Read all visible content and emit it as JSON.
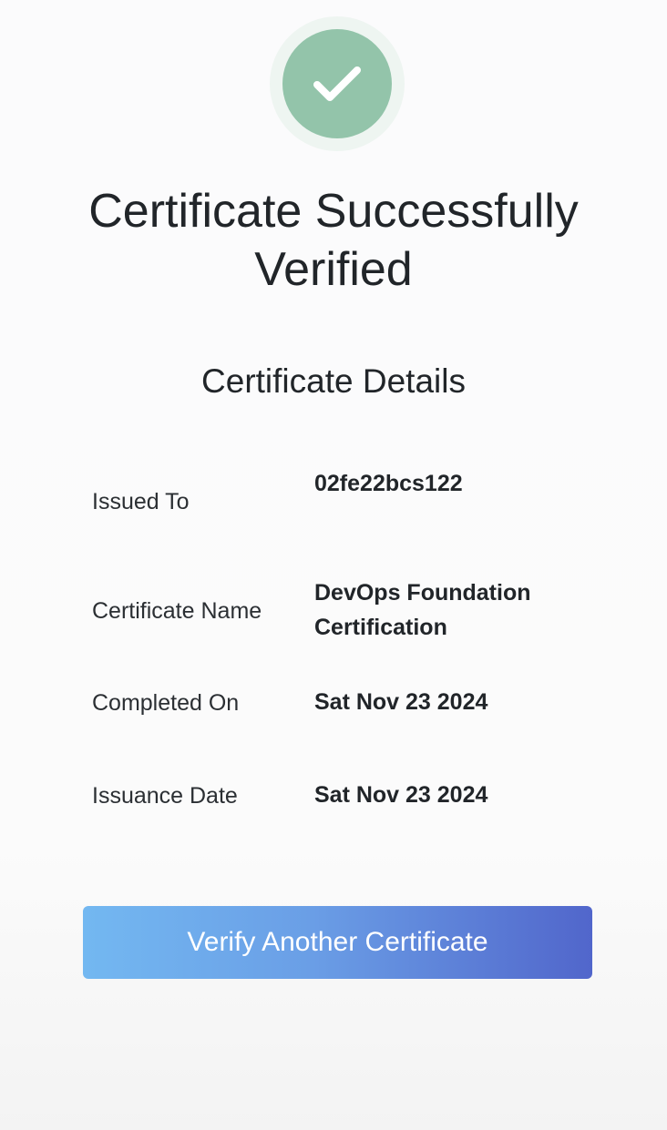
{
  "header": {
    "title": "Certificate Successfully Verified",
    "subtitle": "Certificate Details"
  },
  "status": {
    "icon": "check-icon",
    "color": "#93c4aa",
    "halo_color": "#eef5f1"
  },
  "details": [
    {
      "label": "Issued To",
      "value": "02fe22bcs122"
    },
    {
      "label": "Certificate Name",
      "value": "DevOps Foundation Certification"
    },
    {
      "label": "Completed On",
      "value": "Sat Nov 23 2024"
    },
    {
      "label": "Issuance Date",
      "value": "Sat Nov 23 2024"
    }
  ],
  "actions": {
    "verify_another_label": "Verify Another Certificate",
    "gradient_start": "#73b8f1",
    "gradient_end": "#5166cb"
  }
}
